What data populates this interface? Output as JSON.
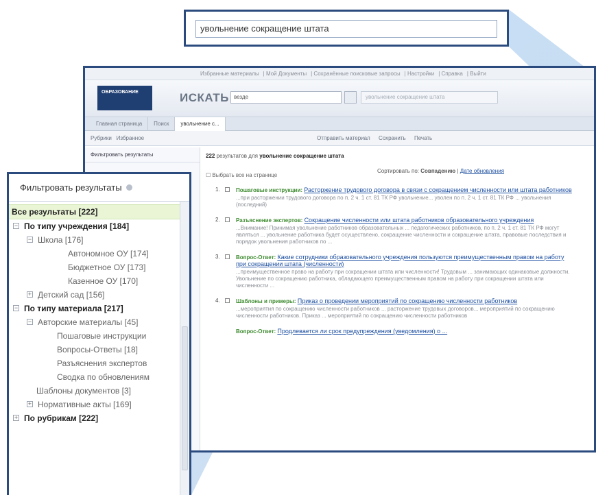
{
  "zoom_search": {
    "query": "увольнение сокращение штата"
  },
  "app": {
    "topmenu": [
      "Избранные материалы",
      "Мой Документы",
      "Сохранённые поисковые запросы",
      "Настройки",
      "Справка",
      "Выйти"
    ],
    "logo_text": "ОБРАЗОВАНИЕ",
    "search_label": "ИСКАТЬ",
    "search_field_value": "везде",
    "search_hint": "увольнение сокращение штата",
    "tabs": [
      "Главная страница",
      "Поиск",
      "увольнение с..."
    ],
    "toolbar_left": [
      "Рубрики",
      "Избранное"
    ],
    "toolbar_right": [
      "Отправить материал",
      "Сохранить",
      "Печать"
    ],
    "sidebar_title": "Фильтровать результаты",
    "summary_count": "222",
    "summary_text": "результатов для",
    "summary_query": "увольнение сокращение штата",
    "sort_label": "Сортировать по:",
    "sort_relevance": "Совпадению",
    "sort_date": "Дате обновления",
    "select_all": "Выбрать все на странице",
    "results": [
      {
        "num": "1.",
        "type": "Пошаговые инструкции:",
        "title": "Расторжение трудового договора в связи с сокращением численности или штата работников",
        "snippet_bold": "ч. 1 ст. 81 ТК РФ",
        "snippet": "...при расторжении трудового договора по п. 2 ч. 1 ст. 81 ТК РФ увольнение... уволен по п. 2 ч. 1 ст. 81 ТК РФ ... увольнения (последний)"
      },
      {
        "num": "2.",
        "type": "Разъяснение экспертов:",
        "title": "Сокращение численности или штата работников образовательного учреждения",
        "snippet_bold": "сокращение штата",
        "snippet": "...Внимание! Принимая увольнение работников образовательных ... педагогических работников, по п. 2 ч. 1 ст. 81 ТК РФ могут являться ... увольнение работника будет осуществлено, сокращение численности и сокращение штата, правовые последствия и порядок увольнения работников по ..."
      },
      {
        "num": "3.",
        "type": "Вопрос-Ответ:",
        "title": "Какие сотрудники образовательного учреждения пользуются преимущественным правом на работу при сокращении штата (численности)",
        "snippet_bold": "сокращении штата",
        "snippet": "...преимущественное право на работу при сокращении штата или численности! Трудовым ... занимающих одинаковые должности. Увольнение по сокращению работника, обладающего преимущественным правом на работу при сокращении штата или численности ..."
      },
      {
        "num": "4.",
        "type": "Шаблоны и примеры:",
        "title": "Приказ о проведении мероприятий по сокращению численности работников",
        "snippet_bold": "сокращение численности",
        "snippet": "...мероприятия по сокращению численности работников ... расторжение трудовых договоров... мероприятий по сокращению численности работников. Приказ ... мероприятий по сокращению численности работников"
      },
      {
        "num": "5.",
        "type": "Вопрос-Ответ:",
        "title": "Продлевается ли срок предупреждения (уведомления) о ...",
        "snippet_bold": "",
        "snippet": ""
      }
    ]
  },
  "filter": {
    "title": "Фильтровать результаты",
    "all_results": "Все результаты [222]",
    "rows": [
      {
        "label": "По типу учреждения [184]",
        "level": 0,
        "toggle": "−"
      },
      {
        "label": "Школа [176]",
        "level": 1,
        "toggle": "−"
      },
      {
        "label": "Автономное ОУ [174]",
        "level": 3,
        "toggle": ""
      },
      {
        "label": "Бюджетное ОУ [173]",
        "level": 3,
        "toggle": ""
      },
      {
        "label": "Казенное ОУ [170]",
        "level": 3,
        "toggle": ""
      },
      {
        "label": "Детский сад [156]",
        "level": 1,
        "toggle": "+"
      },
      {
        "label": "По типу материала [217]",
        "level": 0,
        "toggle": "−"
      },
      {
        "label": "Авторские материалы [45]",
        "level": 1,
        "toggle": "−"
      },
      {
        "label": "Пошаговые инструкции",
        "level": 2,
        "toggle": ""
      },
      {
        "label": "Вопросы-Ответы [18]",
        "level": 2,
        "toggle": ""
      },
      {
        "label": "Разъяснения экспертов",
        "level": 2,
        "toggle": ""
      },
      {
        "label": "Сводка по обновлениям",
        "level": 2,
        "toggle": ""
      },
      {
        "label": "Шаблоны документов [3]",
        "level": 1.5,
        "toggle": ""
      },
      {
        "label": "Нормативные акты [169]",
        "level": 1,
        "toggle": "+"
      },
      {
        "label": "По рубрикам [222]",
        "level": 0,
        "toggle": "+"
      }
    ]
  },
  "colors": {
    "frame": "#2b4a7e",
    "beam": "#7fb0e0",
    "all_results_bg": "#eaf5d6",
    "link": "#1d4fa0",
    "type_label": "#3c8a2e"
  }
}
